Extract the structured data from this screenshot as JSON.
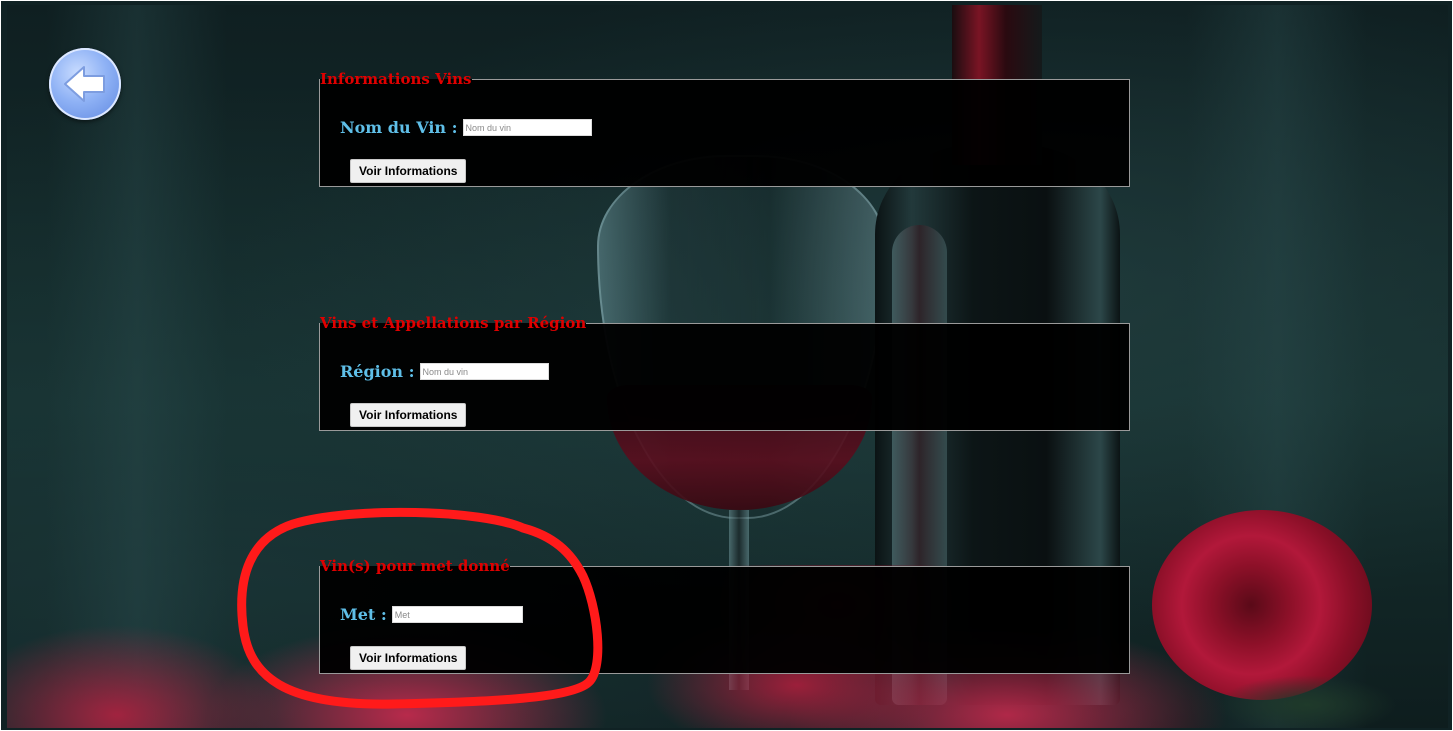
{
  "colors": {
    "legend": "#e00000",
    "label": "#5fbfe8",
    "panel_bg": "#000000",
    "annotation": "#ff1a1a"
  },
  "back_button": {
    "icon": "arrow-left-icon"
  },
  "panels": [
    {
      "legend": "Informations Vins",
      "label": "Nom du Vin :",
      "placeholder": "Nom du vin",
      "button": "Voir Informations"
    },
    {
      "legend": "Vins et Appellations par Région",
      "label": "Région :",
      "placeholder": "Nom du vin",
      "button": "Voir Informations"
    },
    {
      "legend": "Vin(s) pour met donné",
      "label": "Met :",
      "placeholder": "Met",
      "button": "Voir Informations"
    }
  ]
}
